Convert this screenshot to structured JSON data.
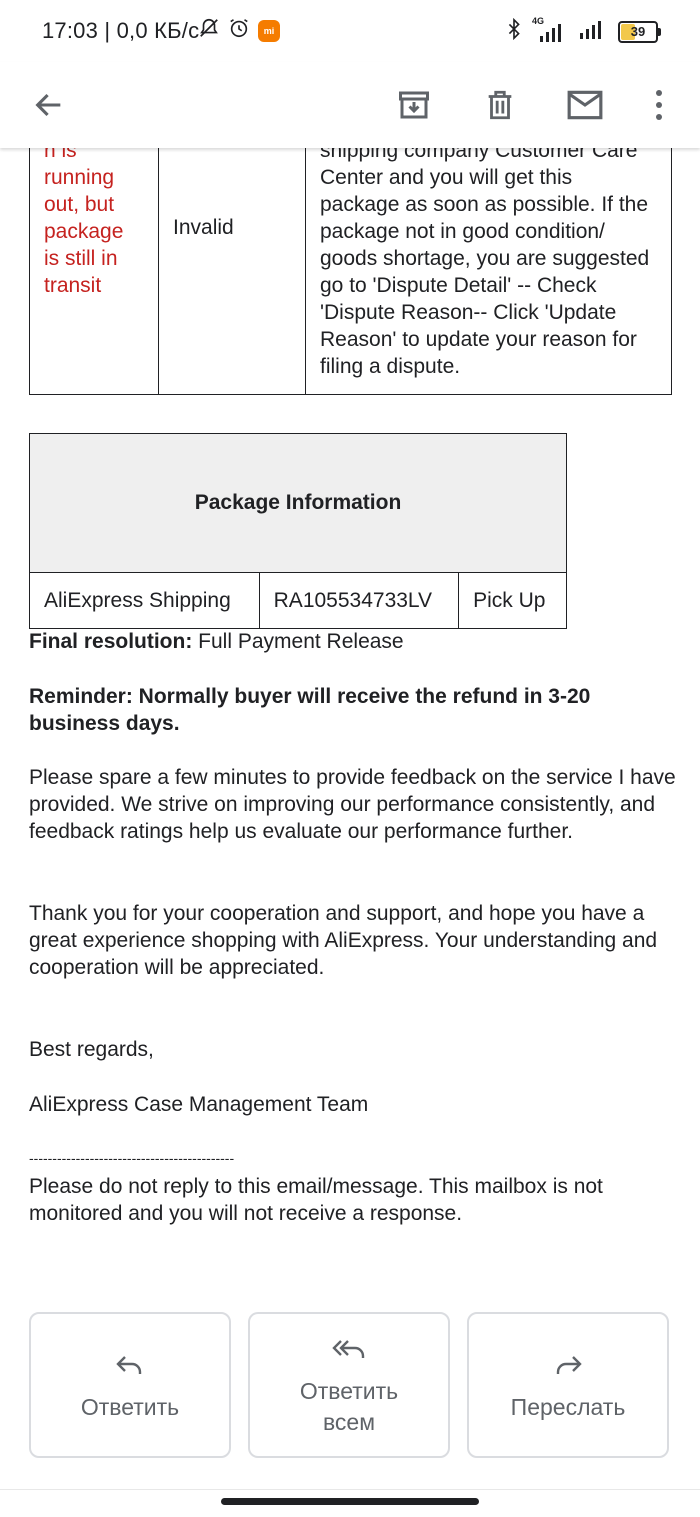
{
  "status_bar": {
    "time": "17:03",
    "speed": "| 0,0 КБ/с",
    "network": "4G",
    "battery": "39"
  },
  "dispute_table": {
    "reason_fragment": [
      "n is",
      "running",
      "out, but",
      "package",
      "is still in",
      "transit"
    ],
    "status": "Invalid",
    "explanation": "shipping company Customer Care Center and you will get this package as soon as possible. If the package not in good condition/ goods shortage, you are suggested go to 'Dispute Detail' -- Check 'Dispute Reason-- Click 'Update Reason' to update your reason for filing a dispute."
  },
  "package": {
    "header": "Package Information",
    "carrier": "AliExpress Shipping",
    "tracking": "RA105534733LV",
    "method": "Pick Up"
  },
  "email": {
    "final_resolution_label": "Final resolution:",
    "final_resolution_value": " Full Payment Release",
    "reminder": "Reminder: Normally buyer will receive the refund in 3-20 business days.",
    "feedback": "Please spare a few minutes to provide feedback on the service I have provided. We strive on improving our performance consistently, and feedback ratings help us evaluate our performance further.",
    "thanks": "Thank you for your cooperation and support, and hope you have a great experience shopping with AliExpress. Your understanding and cooperation will be appreciated.",
    "regards": "Best regards,",
    "team": "AliExpress Case Management Team",
    "dashes": "--------------------------------------------",
    "noreply": "Please do not reply to this email/message. This mailbox is not monitored and you will not receive a response."
  },
  "actions": {
    "reply": "Ответить",
    "reply_all": "Ответить всем",
    "forward": "Переслать"
  }
}
